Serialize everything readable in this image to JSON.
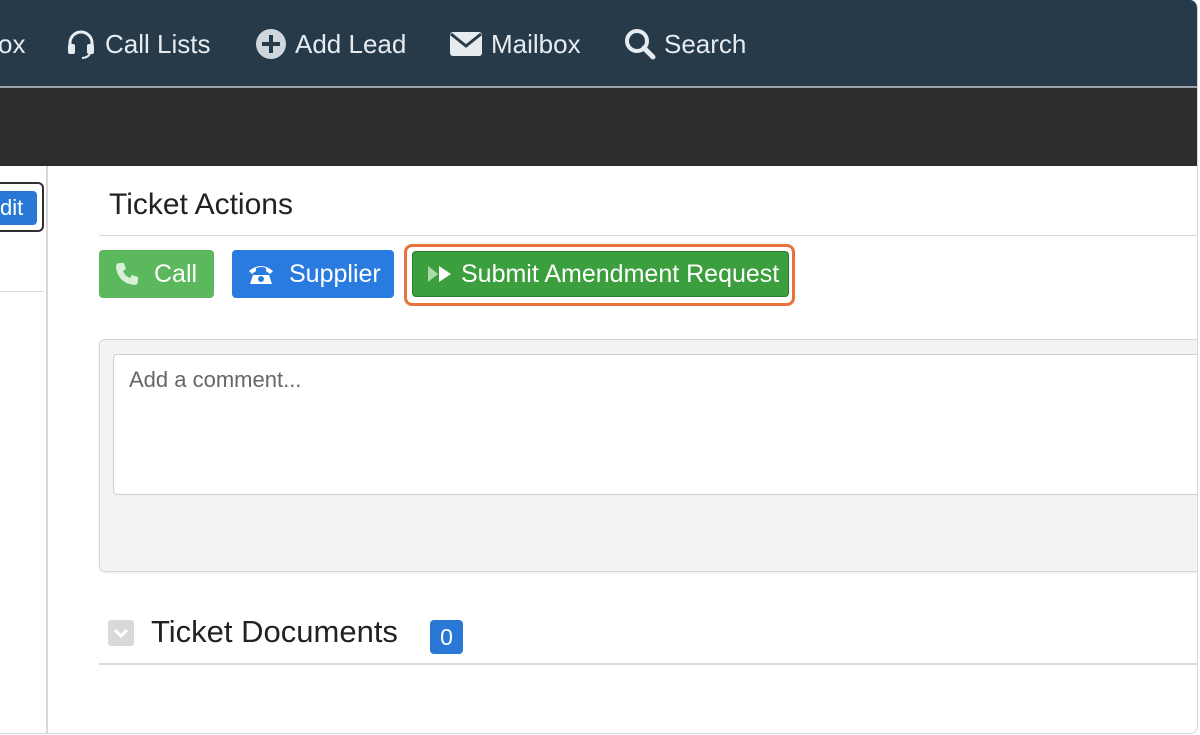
{
  "nav": {
    "partial_label": "ox",
    "items": [
      {
        "label": "Call Lists",
        "icon": "headset-icon"
      },
      {
        "label": "Add Lead",
        "icon": "plus-circle-icon"
      },
      {
        "label": "Mailbox",
        "icon": "envelope-icon"
      },
      {
        "label": "Search",
        "icon": "search-icon"
      }
    ]
  },
  "left_panel": {
    "edit_label": "dit"
  },
  "ticket_actions": {
    "title": "Ticket Actions",
    "buttons": {
      "call": "Call",
      "supplier": "Supplier",
      "submit": "Submit Amendment Request"
    }
  },
  "comment": {
    "placeholder": "Add a comment..."
  },
  "documents": {
    "title": "Ticket Documents",
    "count": "0"
  },
  "colors": {
    "nav_bg": "#273a4a",
    "call_green": "#5cb85c",
    "supplier_blue": "#2a7be0",
    "submit_green": "#3a9f3c",
    "highlight_orange": "#e8733a",
    "badge_blue": "#2a78d6"
  }
}
